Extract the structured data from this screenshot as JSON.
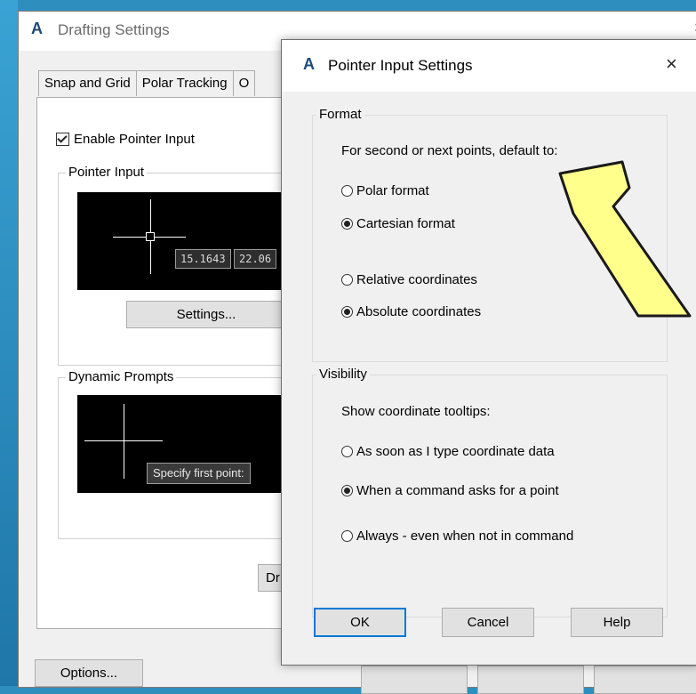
{
  "drafting": {
    "title": "Drafting Settings",
    "close_glyph": "×",
    "logo_glyph": "A",
    "tabs": [
      "Snap and Grid",
      "Polar Tracking",
      "O"
    ],
    "enable_pointer_input": "Enable Pointer Input",
    "enable_pointer_input_checked": true,
    "pointer_input_group": "Pointer Input",
    "coord_x": "15.1643",
    "coord_y": "22.06",
    "settings_button": "Settings...",
    "dynamic_prompts_group": "Dynamic Prompts",
    "prompt_text": "Specify first point:",
    "drafting_button": "Dr",
    "options_button": "Options..."
  },
  "pointer_input_settings": {
    "title": "Pointer Input Settings",
    "logo_glyph": "A",
    "close_glyph": "×",
    "format": {
      "legend": "Format",
      "prompt": "For second or next points, default to:",
      "options_type": [
        {
          "label": "Polar format",
          "checked": false
        },
        {
          "label": "Cartesian format",
          "checked": true
        }
      ],
      "options_coords": [
        {
          "label": "Relative coordinates",
          "checked": false
        },
        {
          "label": "Absolute coordinates",
          "checked": true
        }
      ]
    },
    "visibility": {
      "legend": "Visibility",
      "prompt": "Show coordinate tooltips:",
      "options": [
        {
          "label": "As soon as I type coordinate data",
          "checked": false
        },
        {
          "label": "When a command asks for a point",
          "checked": true
        },
        {
          "label": "Always - even when not in command",
          "checked": false
        }
      ]
    },
    "buttons": {
      "ok": "OK",
      "cancel": "Cancel",
      "help": "Help"
    }
  },
  "annotation": {
    "arrow_color": "#ffff8c",
    "arrow_stroke": "#1a1a1a"
  }
}
